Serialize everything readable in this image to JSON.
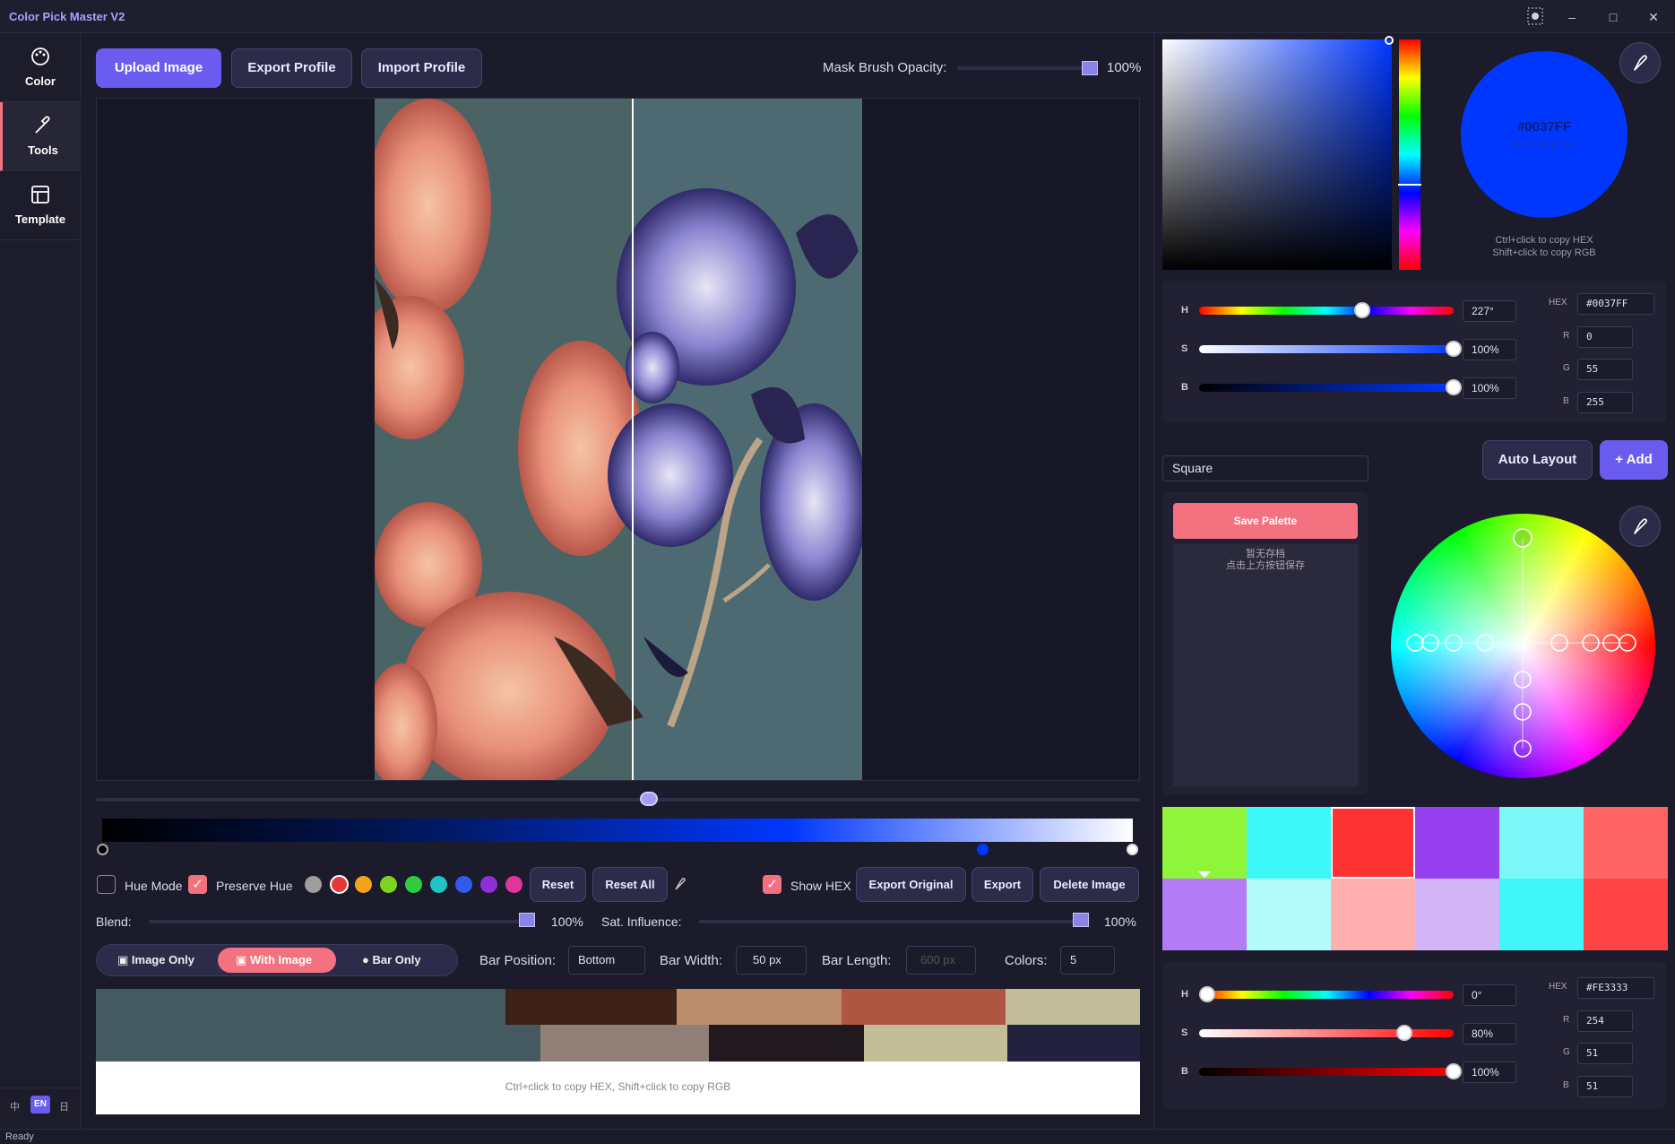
{
  "app": {
    "title": "Color Pick Master V2",
    "status": "Ready"
  },
  "sidebar": {
    "items": [
      {
        "label": "Color"
      },
      {
        "label": "Tools"
      },
      {
        "label": "Template"
      }
    ],
    "lang": {
      "zh": "中",
      "en": "EN",
      "other": "日"
    }
  },
  "toolbar": {
    "upload": "Upload Image",
    "export_profile": "Export Profile",
    "import_profile": "Import Profile",
    "mask_label": "Mask Brush Opacity:",
    "mask_value": "100%",
    "mask_level": 1.0
  },
  "comparison": {
    "split_position": 0.53
  },
  "gradient": {
    "colors": [
      "#000000",
      "#001a66",
      "#0037ff",
      "#ffffff"
    ]
  },
  "controls_row": {
    "hue_mode": "Hue Mode",
    "hue_mode_checked": false,
    "preserve_hue": "Preserve Hue",
    "preserve_hue_checked": true,
    "swatches": [
      "#9e9e9e",
      "#e53935",
      "#f4a21c",
      "#7ed321",
      "#2ecc40",
      "#1fc4c4",
      "#2f5bef",
      "#8e2fd8",
      "#e0359a"
    ],
    "reset": "Reset",
    "reset_all": "Reset All",
    "show_hex": "Show HEX",
    "show_hex_checked": true,
    "export_original": "Export Original",
    "export": "Export",
    "delete_image": "Delete Image"
  },
  "blend": {
    "label": "Blend:",
    "value": "100%",
    "level": 1.0,
    "sat_label": "Sat. Influence:",
    "sat_value": "100%",
    "sat_level": 1.0
  },
  "modes": {
    "image_only": "Image Only",
    "with_image": "With Image",
    "bar_only": "Bar Only",
    "active": "With Image"
  },
  "bar": {
    "position_label": "Bar Position:",
    "position_value": "Bottom",
    "width_label": "Bar Width:",
    "width_value": "50 px",
    "length_label": "Bar Length:",
    "length_value": "600 px",
    "colors_label": "Colors:",
    "colors_value": "5"
  },
  "palette_bar": {
    "row1": [
      "#455a60",
      "#3d2016",
      "#bb8d6c",
      "#ae5642",
      "#c2bc9a"
    ],
    "row2": [
      "#455a60",
      "#8f7f77",
      "#201a1f",
      "#c4bd9a",
      "#23223e"
    ],
    "hint": "Ctrl+click to copy HEX, Shift+click to copy RGB"
  },
  "picker": {
    "hex": "#0037FF",
    "rgb_text": "R:0 G:55 B:255",
    "hint1": "Ctrl+click to copy HEX",
    "hint2": "Shift+click to copy RGB",
    "h_label": "H",
    "h_value": "227°",
    "h": 227,
    "s_label": "S",
    "s_value": "100%",
    "s": 100,
    "b_label": "B",
    "b_value": "100%",
    "b": 100,
    "hex_label": "HEX",
    "hex_value": "#0037FF",
    "r_label": "R",
    "r_value": "0",
    "g_label": "G",
    "g_value": "55",
    "b2_label": "B",
    "b2_value": "255"
  },
  "palette_tools": {
    "mode": "Square",
    "auto_layout": "Auto Layout",
    "add": "+ Add",
    "save": "Save Palette",
    "empty1": "暂无存档",
    "empty2": "点击上方按钮保存"
  },
  "palette_grid": {
    "row1": [
      "#8ff53a",
      "#3ef7f7",
      "#fe3333",
      "#9640f0",
      "#7cf7f7",
      "#fe6464"
    ],
    "row2": [
      "#b37cf5",
      "#b3fbfb",
      "#feb0b0",
      "#d4b6f7",
      "#40f7f7",
      "#fe4444"
    ]
  },
  "picker2": {
    "h_label": "H",
    "h_value": "0°",
    "h": 0,
    "s_label": "S",
    "s_value": "80%",
    "s": 80,
    "b_label": "B",
    "b_value": "100%",
    "b": 100,
    "hex_label": "HEX",
    "hex_value": "#FE3333",
    "r_label": "R",
    "r_value": "254",
    "g_label": "G",
    "g_value": "51",
    "b2_label": "B",
    "b2_value": "51"
  }
}
